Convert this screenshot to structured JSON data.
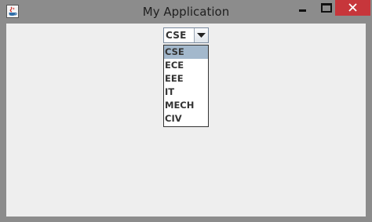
{
  "window": {
    "title": "My Application",
    "close_color": "#c7363b"
  },
  "combo": {
    "selected_value": "CSE",
    "options": [
      {
        "label": "CSE",
        "selected": true
      },
      {
        "label": "ECE",
        "selected": false
      },
      {
        "label": "EEE",
        "selected": false
      },
      {
        "label": "IT",
        "selected": false
      },
      {
        "label": "MECH",
        "selected": false
      },
      {
        "label": "CIV",
        "selected": false
      }
    ],
    "highlight_color": "#a3b8cc"
  },
  "icons": {
    "app": "java-cup-icon",
    "minimize": "minimize-icon",
    "maximize": "maximize-icon",
    "close": "close-icon",
    "dropdown": "chevron-down-icon"
  }
}
